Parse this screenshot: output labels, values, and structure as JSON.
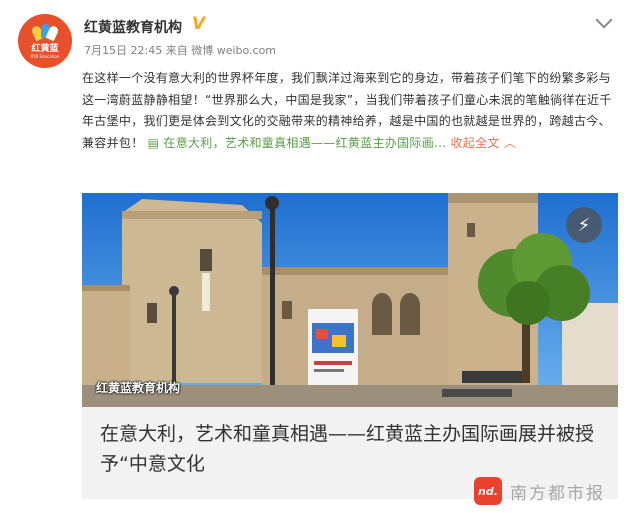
{
  "account": {
    "name": "红黄蓝教育机构",
    "avatar_text": "红黄蓝",
    "avatar_subtext": "RYB Education",
    "verified_icon": "verified-v-badge"
  },
  "meta": {
    "date": "7月15日",
    "time": "22:45",
    "source": "来自 微博 weibo.com"
  },
  "post": {
    "text": "在这样一个没有意大利的世界杯年度，我们飘洋过海来到它的身边，带着孩子们笔下的纷繁多彩与这一湾蔚蓝静静相望！“世界那么大，中国是我家”，当我们带着孩子们童心未泯的笔触徜徉在近千年古堡中，我们更是体会到文化的交融带来的精神给养，越是中国的也就越是世界的，跨越古今、兼容并包！",
    "link_label": "在意大利，艺术和童真相遇——红黄蓝主办国际画...",
    "collapse_label": "收起全文",
    "collapse_icon": "chevron-up-icon"
  },
  "card": {
    "watermark": "红黄蓝教育机构",
    "play_icon": "lightning-icon",
    "title": "在意大利，艺术和童真相遇——红黄蓝主办国际画展并被授予“中意文化"
  },
  "footer": {
    "logo_text": "nd.",
    "source_name": "南方都市报"
  },
  "colors": {
    "accent": "#eb7350",
    "link_green": "#5a9e4a",
    "avatar_bg": "#e8502c",
    "verified": "#f5a623"
  }
}
